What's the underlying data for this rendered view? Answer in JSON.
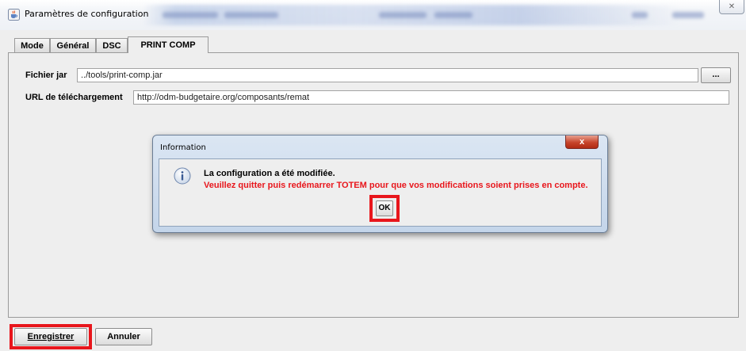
{
  "window": {
    "title": "Paramètres de configuration",
    "close_glyph": "✕"
  },
  "tabs": [
    {
      "label": "Mode",
      "active": false
    },
    {
      "label": "Général",
      "active": false
    },
    {
      "label": "DSC",
      "active": false
    },
    {
      "label": "PRINT COMP",
      "active": true
    }
  ],
  "form": {
    "jar_label": "Fichier jar",
    "jar_value": "../tools/print-comp.jar",
    "browse_label": "...",
    "url_label": "URL de téléchargement",
    "url_value": "http://odm-budgetaire.org/composants/remat"
  },
  "dialog": {
    "title": "Information",
    "close_glyph": "x",
    "message_line1": "La configuration a été modifiée.",
    "message_line2": "Veuillez quitter puis redémarrer TOTEM pour que vos modifications soient prises en compte.",
    "ok_label": "OK"
  },
  "footer": {
    "save_label": "Enregistrer",
    "cancel_label": "Annuler"
  },
  "colors": {
    "highlight": "#e8161c",
    "warning_text": "#e8161c"
  },
  "icons": {
    "app": "java-cup-icon",
    "info": "info-icon"
  }
}
